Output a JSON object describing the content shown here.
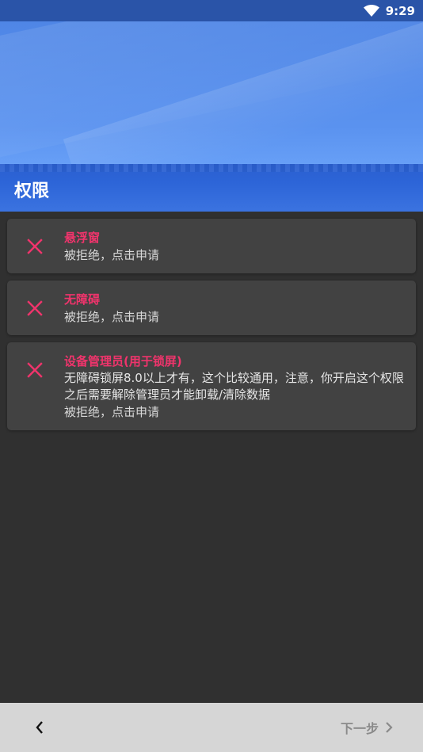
{
  "status_bar": {
    "time": "9:29",
    "icons": [
      "wifi-icon"
    ]
  },
  "header": {
    "title": "权限"
  },
  "permissions": [
    {
      "icon": "close-icon",
      "name": "悬浮窗",
      "description": "",
      "state": "被拒绝，点击申请"
    },
    {
      "icon": "close-icon",
      "name": "无障碍",
      "description": "",
      "state": "被拒绝，点击申请"
    },
    {
      "icon": "close-icon",
      "name": "设备管理员(用于锁屏)",
      "description": "无障碍锁屏8.0以上才有，这个比较通用，注意，你开启这个权限之后需要解除管理员才能卸载/清除数据",
      "state": "被拒绝，点击申请"
    }
  ],
  "bottom_bar": {
    "back_icon": "chevron-left-icon",
    "next_label": "下一步",
    "next_icon": "chevron-right-icon"
  },
  "colors": {
    "accent": "#f0346c",
    "header": "#4f86e6",
    "background": "#303030",
    "card": "#424242"
  }
}
